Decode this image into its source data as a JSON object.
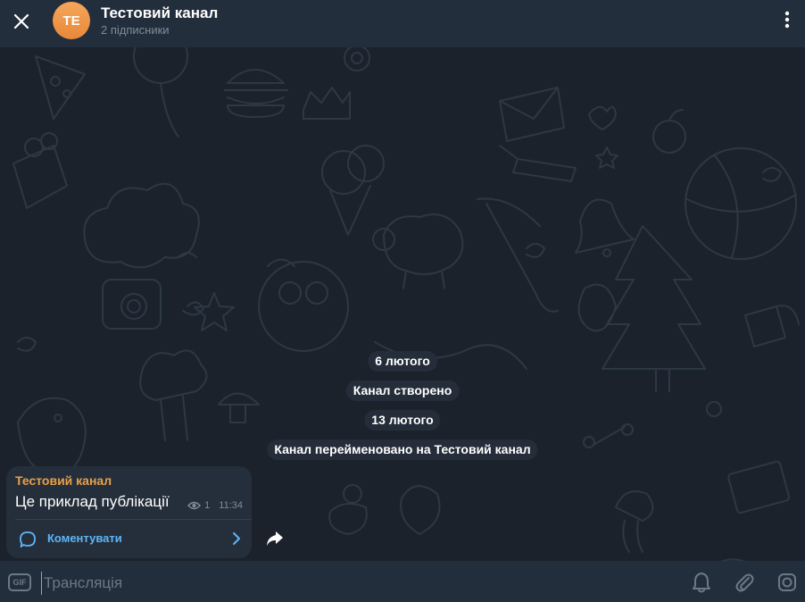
{
  "header": {
    "avatar_initials": "TE",
    "title": "Тестовий канал",
    "subtitle": "2 підписники",
    "avatar_color": "#ee9440"
  },
  "service_messages": [
    "6 лютого",
    "Канал створено",
    "13 лютого",
    "Канал перейменовано на Тестовий канал"
  ],
  "message": {
    "author": "Тестовий канал",
    "text": "Це приклад публікації",
    "views": "1",
    "time": "11:34",
    "comments_label": "Коментувати"
  },
  "input": {
    "placeholder": "Трансляція",
    "gif_label": "GIF"
  },
  "colors": {
    "accent": "#5eb5f7",
    "author": "#e8a04a",
    "header_bg": "#232e3c",
    "chat_bg": "#1b222b"
  },
  "icons": [
    "close-icon",
    "more-vertical-icon",
    "eye-icon",
    "comment-icon",
    "chevron-right-icon",
    "share-icon",
    "gif-icon",
    "bell-icon",
    "paperclip-icon",
    "instagram-icon"
  ]
}
